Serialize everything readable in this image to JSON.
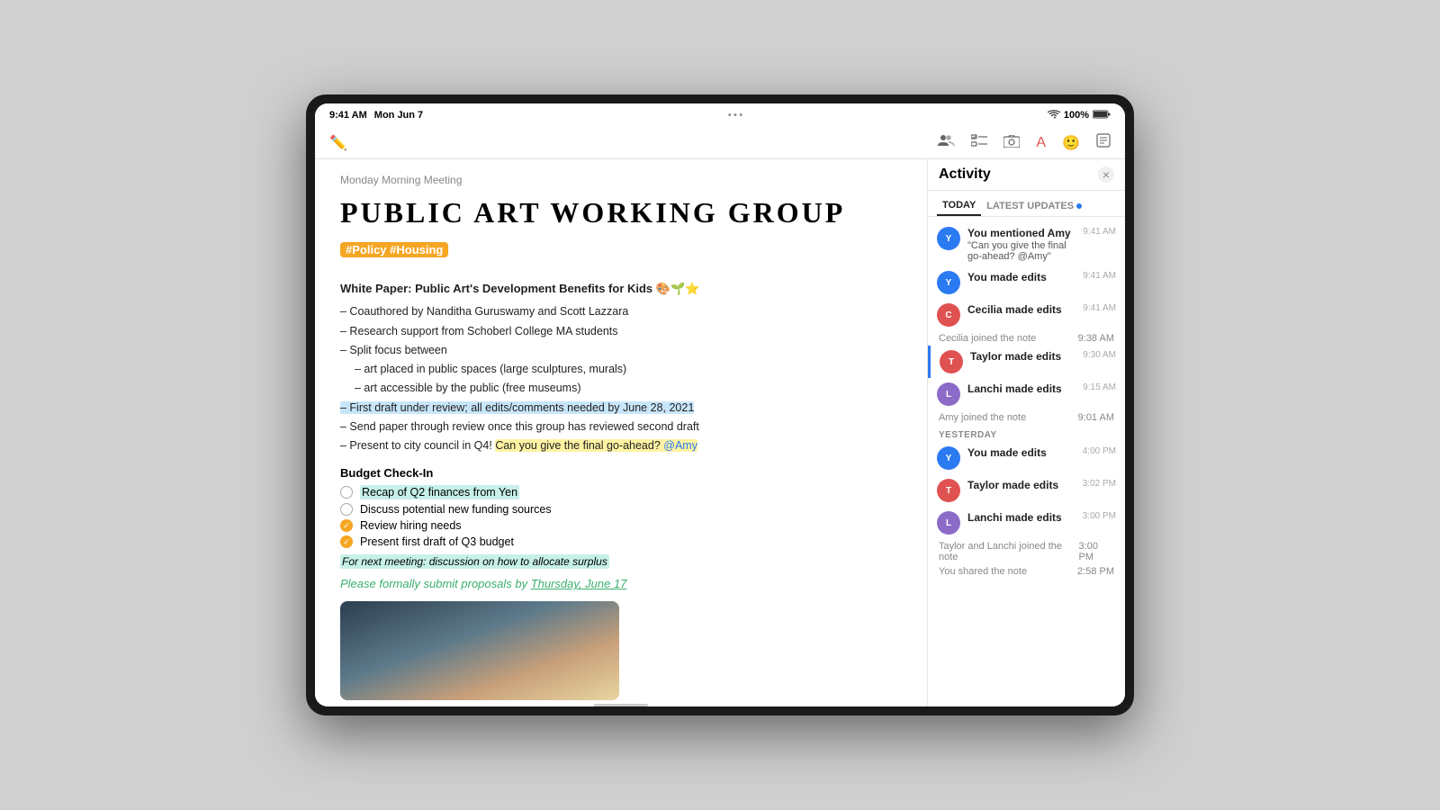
{
  "device": {
    "statusBar": {
      "time": "9:41 AM",
      "date": "Mon Jun 7",
      "dots": "• • •",
      "battery": "100%",
      "wifi": "WiFi"
    },
    "toolbar": {
      "icons": [
        "lasso-icon",
        "people-icon",
        "checklist-icon",
        "camera-icon",
        "markup-icon",
        "emoji-icon",
        "compose-icon"
      ]
    }
  },
  "note": {
    "breadcrumb": "Monday Morning Meeting",
    "title": "PUBLIC ART WORKING GROUP",
    "tags": "#Policy #Housing",
    "paperSection": {
      "title": "White Paper: Public Art's Development Benefits for Kids 🎨🌱⭐",
      "lines": [
        "– Coauthored by Nanditha Guruswamy and Scott Lazzara",
        "– Research support from Schoberl College MA students",
        "– Split focus between",
        "    – art placed in public spaces (large sculptures, murals)",
        "    – art accessible by the public (free museums)",
        "– First draft under review; all edits/comments needed by June 28, 2021",
        "– Send paper through review once this group has reviewed second draft",
        "– Present to city council in Q4!"
      ],
      "highlightLine": "– First draft under review; all edits/comments needed by June 28, 2021",
      "mentionLine": "Can you give the final go-ahead? @Amy",
      "mentionLinePrefix": "– Present to city council in Q4! "
    },
    "budgetSection": {
      "title": "Budget Check-In",
      "items": [
        {
          "text": "Recap of Q2 finances from Yen",
          "checked": false,
          "highlight": true
        },
        {
          "text": "Discuss potential new funding sources",
          "checked": false,
          "highlight": false
        },
        {
          "text": "Review hiring needs",
          "checked": true,
          "highlight": false
        },
        {
          "text": "Present first draft of Q3 budget",
          "checked": true,
          "highlight": false
        }
      ],
      "note": "For next meeting: discussion on how to allocate surplus",
      "closing": "Please formally submit proposals by Thursday, June 17"
    }
  },
  "activity": {
    "title": "Activity",
    "closeLabel": "×",
    "tabs": [
      {
        "label": "TODAY",
        "active": true
      },
      {
        "label": "LATEST UPDATES",
        "active": false,
        "badge": true
      }
    ],
    "todayItems": [
      {
        "type": "activity",
        "avatar": "you",
        "name": "You mentioned Amy",
        "desc": "\"Can you give the final go-ahead? @Amy\"",
        "time": "9:41 AM",
        "highlighted": false
      },
      {
        "type": "activity",
        "avatar": "you",
        "name": "You made edits",
        "desc": "",
        "time": "9:41 AM",
        "highlighted": false
      },
      {
        "type": "activity",
        "avatar": "cecilia",
        "name": "Cecilia made edits",
        "desc": "",
        "time": "9:41 AM",
        "highlighted": false
      },
      {
        "type": "system",
        "text": "Cecilia joined the note",
        "time": "9:38 AM"
      },
      {
        "type": "activity",
        "avatar": "taylor",
        "name": "Taylor made edits",
        "desc": "",
        "time": "9:30 AM",
        "highlighted": true
      },
      {
        "type": "activity",
        "avatar": "lanchi",
        "name": "Lanchi made edits",
        "desc": "",
        "time": "9:15 AM",
        "highlighted": false
      },
      {
        "type": "system",
        "text": "Amy joined the note",
        "time": "9:01 AM"
      }
    ],
    "yesterdaySection": "YESTERDAY",
    "yesterdayItems": [
      {
        "type": "activity",
        "avatar": "you",
        "name": "You made edits",
        "desc": "",
        "time": "4:00 PM",
        "highlighted": false
      },
      {
        "type": "activity",
        "avatar": "taylor",
        "name": "Taylor made edits",
        "desc": "",
        "time": "3:02 PM",
        "highlighted": false
      },
      {
        "type": "activity",
        "avatar": "lanchi",
        "name": "Lanchi made edits",
        "desc": "",
        "time": "3:00 PM",
        "highlighted": false
      },
      {
        "type": "system",
        "text": "Taylor and Lanchi joined the note",
        "time": "3:00 PM"
      },
      {
        "type": "system",
        "text": "You shared the note",
        "time": "2:58 PM"
      }
    ]
  }
}
